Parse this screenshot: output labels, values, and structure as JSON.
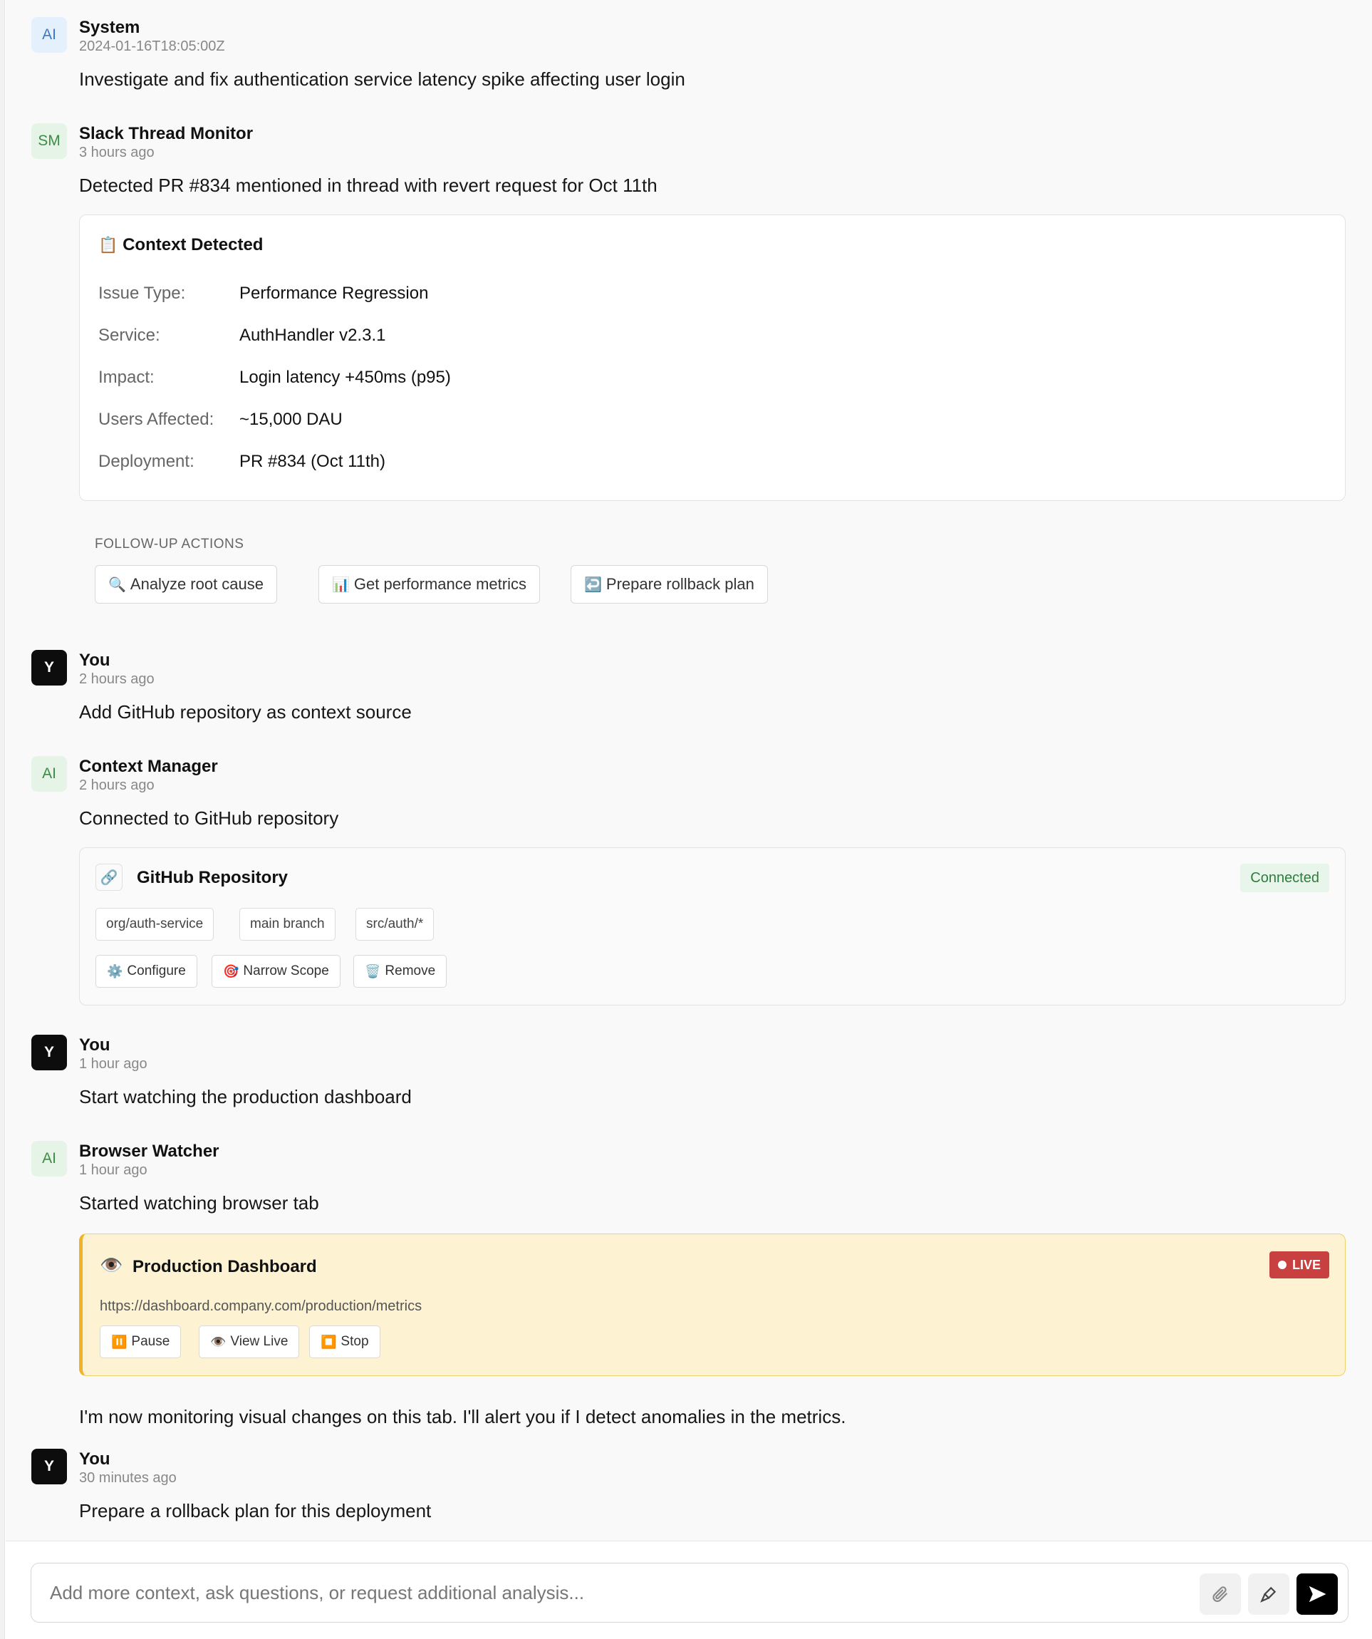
{
  "messages": {
    "system": {
      "avatar": "AI",
      "name": "System",
      "time": "2024-01-16T18:05:00Z",
      "text": "Investigate and fix authentication service latency spike affecting user login"
    },
    "slack": {
      "avatar": "SM",
      "name": "Slack Thread Monitor",
      "time": "3 hours ago",
      "text": "Detected PR #834 mentioned in thread with revert request for Oct 11th",
      "context": {
        "icon": "clipboard-icon",
        "title": "Context Detected",
        "rows": [
          {
            "key": "Issue Type:",
            "value": "Performance Regression"
          },
          {
            "key": "Service:",
            "value": "AuthHandler v2.3.1"
          },
          {
            "key": "Impact:",
            "value": "Login latency +450ms (p95)"
          },
          {
            "key": "Users Affected:",
            "value": "~15,000 DAU"
          },
          {
            "key": "Deployment:",
            "value": "PR #834 (Oct 11th)"
          }
        ]
      },
      "followup": {
        "label": "FOLLOW-UP ACTIONS",
        "actions": [
          {
            "icon": "magnifier-icon",
            "label": "Analyze root cause"
          },
          {
            "icon": "bar-chart-icon",
            "label": "Get performance metrics"
          },
          {
            "icon": "return-arrow-icon",
            "label": "Prepare rollback plan"
          }
        ]
      }
    },
    "you1": {
      "avatar": "Y",
      "name": "You",
      "time": "2 hours ago",
      "text": "Add GitHub repository as context source"
    },
    "context_manager": {
      "avatar": "AI",
      "name": "Context Manager",
      "time": "2 hours ago",
      "text": "Connected to GitHub repository",
      "github": {
        "title": "GitHub Repository",
        "status": "Connected",
        "tags": [
          "org/auth-service",
          "main branch",
          "src/auth/*"
        ],
        "actions": [
          {
            "icon": "gear-icon",
            "label": "Configure"
          },
          {
            "icon": "target-icon",
            "label": "Narrow Scope"
          },
          {
            "icon": "trash-icon",
            "label": "Remove"
          }
        ]
      }
    },
    "you2": {
      "avatar": "Y",
      "name": "You",
      "time": "1 hour ago",
      "text": "Start watching the production dashboard"
    },
    "browser_watcher": {
      "avatar": "AI",
      "name": "Browser Watcher",
      "time": "1 hour ago",
      "text": "Started watching browser tab",
      "watch": {
        "title": "Production Dashboard",
        "url": "https://dashboard.company.com/production/metrics",
        "live": "LIVE",
        "actions": [
          {
            "icon": "pause-icon",
            "label": "Pause"
          },
          {
            "icon": "eye-icon",
            "label": "View Live"
          },
          {
            "icon": "stop-icon",
            "label": "Stop"
          }
        ]
      },
      "followup_text": "I'm now monitoring visual changes on this tab. I'll alert you if I detect anomalies in the metrics."
    },
    "you3": {
      "avatar": "Y",
      "name": "You",
      "time": "30 minutes ago",
      "text": "Prepare a rollback plan for this deployment"
    }
  },
  "composer": {
    "placeholder": "Add more context, ask questions, or request additional analysis...",
    "attach_icon": "paperclip-icon",
    "mic_icon": "microphone-icon",
    "send_icon": "send-arrow-icon"
  },
  "colors": {
    "live_badge": "#c94040",
    "connected_badge": "#2e7d3a",
    "watch_accent": "#f1b22a"
  }
}
